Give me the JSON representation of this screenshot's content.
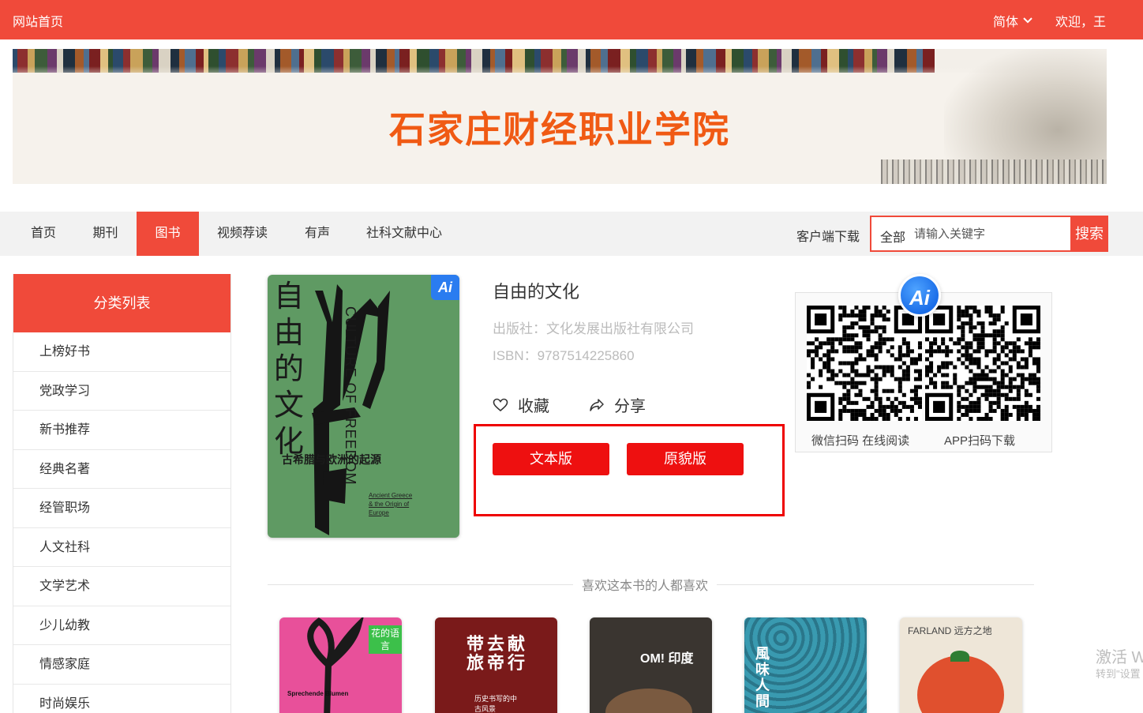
{
  "topbar": {
    "home": "网站首页",
    "language": "简体",
    "welcome": "欢迎，王"
  },
  "banner": {
    "title": "石家庄财经职业学院"
  },
  "nav": {
    "items": [
      "首页",
      "期刊",
      "图书",
      "视频荐读",
      "有声",
      "社科文献中心"
    ],
    "active": "图书",
    "download": "客户端下载"
  },
  "search": {
    "scope": "全部",
    "placeholder": "请输入关键字",
    "button": "搜索"
  },
  "sidebar": {
    "heading": "分类列表",
    "categories": [
      "上榜好书",
      "党政学习",
      "新书推荐",
      "经典名著",
      "经管职场",
      "人文社科",
      "文学艺术",
      "少儿幼教",
      "情感家庭",
      "时尚娱乐"
    ]
  },
  "book": {
    "title": "自由的文化",
    "publisher": "出版社：文化发展出版社有限公司",
    "isbn": "ISBN：9787514225860",
    "favorite": "收藏",
    "share": "分享",
    "text_version": "文本版",
    "original_version": "原貌版",
    "cover": {
      "title_vertical": "自由的文化",
      "english_title": "CULTURE OF FREEDOM",
      "subtitle": "古希腊与欧洲的起源",
      "english_sub": "Ancient Greece & the Origin of Europe",
      "ai_badge": "Ai"
    }
  },
  "qr": {
    "ai_label": "Ai",
    "left_label": "微信扫码 在线阅读",
    "right_label": "APP扫码下载"
  },
  "recommend": {
    "heading": "喜欢这本书的人都喜欢",
    "books": [
      {
        "color": "#e8509a",
        "tag": "花的语言",
        "sub": "Sprechende Blumen"
      },
      {
        "color": "#7a1a1a",
        "tag": "带去献旅帝行",
        "sub": "历史书写的中古风景"
      },
      {
        "color": "#3a3530",
        "tag": "OM! 印度",
        "sub": ""
      },
      {
        "color": "#2f8aa0",
        "tag": "風味人間",
        "sub": ""
      },
      {
        "color": "#eee6d8",
        "tag": "FARLAND 远方之地",
        "sub": ""
      }
    ]
  },
  "watermark": {
    "line1": "激活 W",
    "line2": "转到\"设置"
  }
}
